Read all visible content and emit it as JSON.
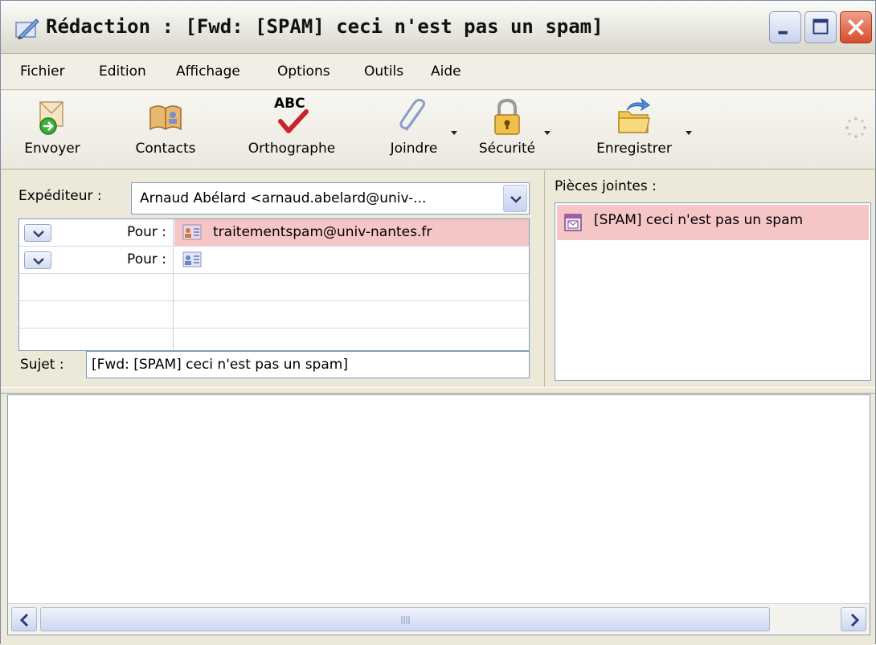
{
  "window": {
    "title": "Rédaction : [Fwd: [SPAM] ceci n'est pas un spam]"
  },
  "menu": {
    "items": [
      {
        "label": "Fichier"
      },
      {
        "label": "Edition"
      },
      {
        "label": "Affichage"
      },
      {
        "label": "Options"
      },
      {
        "label": "Outils"
      },
      {
        "label": "Aide"
      }
    ]
  },
  "toolbar": {
    "send": "Envoyer",
    "contacts": "Contacts",
    "spell": "Orthographe",
    "spell_icon_text": "ABC",
    "attach": "Joindre",
    "security": "Sécurité",
    "save": "Enregistrer"
  },
  "header": {
    "from_label": "Expéditeur :",
    "from_value": "Arnaud Abélard <arnaud.abelard@univ-...",
    "recipients": [
      {
        "type": "Pour :",
        "address": "traitementspam@univ-nantes.fr",
        "selected": true
      },
      {
        "type": "Pour :",
        "address": "",
        "selected": false
      }
    ],
    "subject_label": "Sujet :",
    "subject_value": "[Fwd: [SPAM] ceci n'est pas un spam]"
  },
  "attachments": {
    "label": "Pièces jointes :",
    "items": [
      {
        "name": "[SPAM] ceci n'est pas un spam"
      }
    ]
  },
  "colors": {
    "selection": "#f6c6c6",
    "chrome": "#ece9d8",
    "close_button": "#d64b2b"
  }
}
